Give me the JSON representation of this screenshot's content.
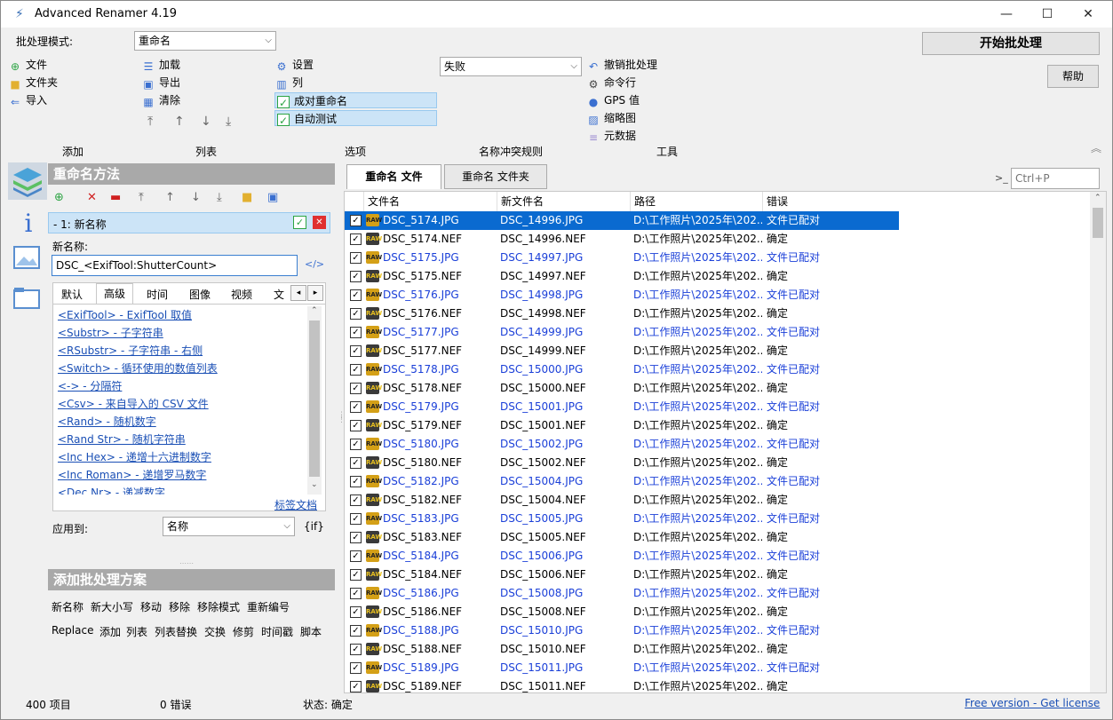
{
  "window": {
    "title": "Advanced Renamer 4.19",
    "minimize": "—",
    "maximize": "☐",
    "close": "✕"
  },
  "toolbar": {
    "batch_mode_label": "批处理模式:",
    "batch_mode_value": "重命名",
    "add_group": {
      "items": [
        "文件",
        "文件夹",
        "导入"
      ],
      "label": "添加"
    },
    "list_group": {
      "items": [
        "加载",
        "导出",
        "清除"
      ],
      "label": "列表"
    },
    "options_group": {
      "items": [
        "设置",
        "列",
        "成对重命名",
        "自动测试"
      ],
      "label": "选项"
    },
    "conflict_value": "失败",
    "conflict_label": "名称冲突规则",
    "tools_group": {
      "items": [
        "撤销批处理",
        "命令行",
        "GPS 值",
        "缩略图",
        "元数据"
      ],
      "label": "工具"
    },
    "start_button": "开始批处理",
    "help_button": "帮助"
  },
  "method_panel": {
    "header": "重命名方法",
    "method_item": "- 1: 新名称",
    "new_name_label": "新名称:",
    "new_name_value": "DSC_<ExifTool:ShutterCount>",
    "code_icon": "</>",
    "tabs": [
      "默认",
      "高级",
      "时间",
      "图像",
      "视频",
      "文件"
    ],
    "active_tab": "高级",
    "tags": [
      "<ExifTool> - ExifTool 取值",
      "<Substr> - 子字符串",
      "<RSubstr> - 子字符串 - 右侧",
      "<Switch> - 循环使用的数值列表",
      "<-> - 分隔符",
      "<Csv> - 来自导入的 CSV 文件",
      "<Rand> - 随机数字",
      "<Rand Str> - 随机字符串",
      "<Inc Hex> - 递增十六进制数字",
      "<Inc Roman> - 递增罗马数字",
      "<Dec Nr> - 递减数字"
    ],
    "tag_docs": "标签文档",
    "apply_to_label": "应用到:",
    "apply_to_value": "名称",
    "if_label": "{if}"
  },
  "add_panel": {
    "header": "添加批处理方案",
    "row1": [
      "新名称",
      "新大小写",
      "移动",
      "移除",
      "移除模式",
      "重新编号"
    ],
    "row2": [
      "Replace",
      "添加",
      "列表",
      "列表替换",
      "交换",
      "修剪",
      "时间戳",
      "脚本"
    ]
  },
  "file_tabs": {
    "rename_files": "重命名 文件",
    "rename_folders": "重命名 文件夹"
  },
  "search": {
    "prompt": ">_",
    "placeholder": "Ctrl+P"
  },
  "grid": {
    "headers": [
      "文件名",
      "新文件名",
      "路径",
      "错误"
    ],
    "rows": [
      {
        "name": "DSC_5174.JPG",
        "new": "DSC_14996.JPG",
        "path": "D:\\工作照片\\2025年\\202...",
        "err": "文件已配对",
        "type": "jpg",
        "selected": true
      },
      {
        "name": "DSC_5174.NEF",
        "new": "DSC_14996.NEF",
        "path": "D:\\工作照片\\2025年\\202...",
        "err": "确定",
        "type": "raw"
      },
      {
        "name": "DSC_5175.JPG",
        "new": "DSC_14997.JPG",
        "path": "D:\\工作照片\\2025年\\202...",
        "err": "文件已配对",
        "type": "jpg"
      },
      {
        "name": "DSC_5175.NEF",
        "new": "DSC_14997.NEF",
        "path": "D:\\工作照片\\2025年\\202...",
        "err": "确定",
        "type": "raw"
      },
      {
        "name": "DSC_5176.JPG",
        "new": "DSC_14998.JPG",
        "path": "D:\\工作照片\\2025年\\202...",
        "err": "文件已配对",
        "type": "jpg"
      },
      {
        "name": "DSC_5176.NEF",
        "new": "DSC_14998.NEF",
        "path": "D:\\工作照片\\2025年\\202...",
        "err": "确定",
        "type": "raw"
      },
      {
        "name": "DSC_5177.JPG",
        "new": "DSC_14999.JPG",
        "path": "D:\\工作照片\\2025年\\202...",
        "err": "文件已配对",
        "type": "jpg"
      },
      {
        "name": "DSC_5177.NEF",
        "new": "DSC_14999.NEF",
        "path": "D:\\工作照片\\2025年\\202...",
        "err": "确定",
        "type": "raw"
      },
      {
        "name": "DSC_5178.JPG",
        "new": "DSC_15000.JPG",
        "path": "D:\\工作照片\\2025年\\202...",
        "err": "文件已配对",
        "type": "jpg"
      },
      {
        "name": "DSC_5178.NEF",
        "new": "DSC_15000.NEF",
        "path": "D:\\工作照片\\2025年\\202...",
        "err": "确定",
        "type": "raw"
      },
      {
        "name": "DSC_5179.JPG",
        "new": "DSC_15001.JPG",
        "path": "D:\\工作照片\\2025年\\202...",
        "err": "文件已配对",
        "type": "jpg"
      },
      {
        "name": "DSC_5179.NEF",
        "new": "DSC_15001.NEF",
        "path": "D:\\工作照片\\2025年\\202...",
        "err": "确定",
        "type": "raw"
      },
      {
        "name": "DSC_5180.JPG",
        "new": "DSC_15002.JPG",
        "path": "D:\\工作照片\\2025年\\202...",
        "err": "文件已配对",
        "type": "jpg"
      },
      {
        "name": "DSC_5180.NEF",
        "new": "DSC_15002.NEF",
        "path": "D:\\工作照片\\2025年\\202...",
        "err": "确定",
        "type": "raw"
      },
      {
        "name": "DSC_5182.JPG",
        "new": "DSC_15004.JPG",
        "path": "D:\\工作照片\\2025年\\202...",
        "err": "文件已配对",
        "type": "jpg"
      },
      {
        "name": "DSC_5182.NEF",
        "new": "DSC_15004.NEF",
        "path": "D:\\工作照片\\2025年\\202...",
        "err": "确定",
        "type": "raw"
      },
      {
        "name": "DSC_5183.JPG",
        "new": "DSC_15005.JPG",
        "path": "D:\\工作照片\\2025年\\202...",
        "err": "文件已配对",
        "type": "jpg"
      },
      {
        "name": "DSC_5183.NEF",
        "new": "DSC_15005.NEF",
        "path": "D:\\工作照片\\2025年\\202...",
        "err": "确定",
        "type": "raw"
      },
      {
        "name": "DSC_5184.JPG",
        "new": "DSC_15006.JPG",
        "path": "D:\\工作照片\\2025年\\202...",
        "err": "文件已配对",
        "type": "jpg"
      },
      {
        "name": "DSC_5184.NEF",
        "new": "DSC_15006.NEF",
        "path": "D:\\工作照片\\2025年\\202...",
        "err": "确定",
        "type": "raw"
      },
      {
        "name": "DSC_5186.JPG",
        "new": "DSC_15008.JPG",
        "path": "D:\\工作照片\\2025年\\202...",
        "err": "文件已配对",
        "type": "jpg"
      },
      {
        "name": "DSC_5186.NEF",
        "new": "DSC_15008.NEF",
        "path": "D:\\工作照片\\2025年\\202...",
        "err": "确定",
        "type": "raw"
      },
      {
        "name": "DSC_5188.JPG",
        "new": "DSC_15010.JPG",
        "path": "D:\\工作照片\\2025年\\202...",
        "err": "文件已配对",
        "type": "jpg"
      },
      {
        "name": "DSC_5188.NEF",
        "new": "DSC_15010.NEF",
        "path": "D:\\工作照片\\2025年\\202...",
        "err": "确定",
        "type": "raw"
      },
      {
        "name": "DSC_5189.JPG",
        "new": "DSC_15011.JPG",
        "path": "D:\\工作照片\\2025年\\202...",
        "err": "文件已配对",
        "type": "jpg"
      },
      {
        "name": "DSC_5189.NEF",
        "new": "DSC_15011.NEF",
        "path": "D:\\工作照片\\2025年\\202...",
        "err": "确定",
        "type": "raw"
      }
    ]
  },
  "status": {
    "items": "400 项目",
    "errors": "0 错误",
    "state": "状态: 确定",
    "free_version": "Free version - Get license"
  },
  "colors": {
    "selection": "#0a6ad0",
    "paired_text": "#1a3fd8",
    "panel_header": "#a9a9a9"
  }
}
